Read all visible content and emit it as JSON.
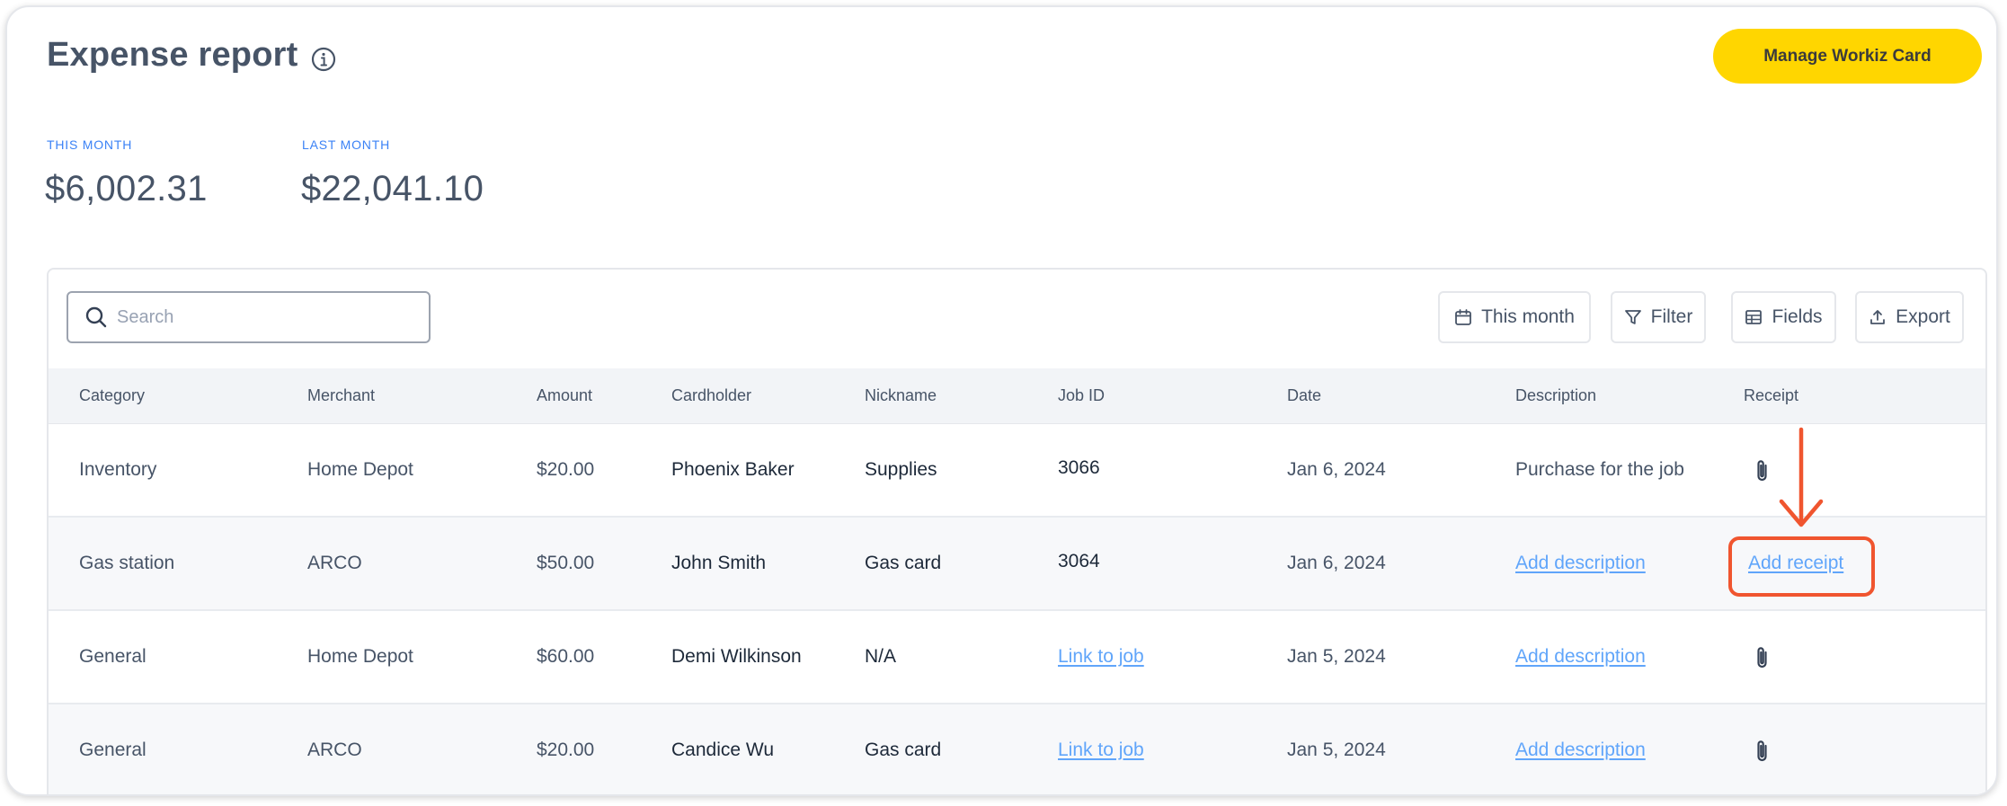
{
  "header": {
    "title": "Expense report",
    "manage_button": "Manage Workiz Card"
  },
  "stats": {
    "this_month_label": "THIS MONTH",
    "this_month_value": "$6,002.31",
    "last_month_label": "LAST MONTH",
    "last_month_value": "$22,041.10"
  },
  "toolbar": {
    "search_placeholder": "Search",
    "this_month": "This month",
    "filter": "Filter",
    "fields": "Fields",
    "export": "Export"
  },
  "table": {
    "columns": [
      "Category",
      "Merchant",
      "Amount",
      "Cardholder",
      "Nickname",
      "Job ID",
      "Date",
      "Description",
      "Receipt"
    ],
    "rows": [
      {
        "category": "Inventory",
        "merchant": "Home Depot",
        "amount": "$20.00",
        "cardholder": "Phoenix Baker",
        "nickname": "Supplies",
        "job_id": "3066",
        "date": "Jan 6, 2024",
        "description": "Purchase for the job",
        "receipt": "attachment-icon"
      },
      {
        "category": "Gas station",
        "merchant": "ARCO",
        "amount": "$50.00",
        "cardholder": "John Smith",
        "nickname": "Gas card",
        "job_id": "3064",
        "date": "Jan 6, 2024",
        "description": "Add description",
        "receipt": "Add receipt"
      },
      {
        "category": "General",
        "merchant": "Home Depot",
        "amount": "$60.00",
        "cardholder": "Demi Wilkinson",
        "nickname": "N/A",
        "job_id": "Link to job",
        "date": "Jan 5, 2024",
        "description": "Add description",
        "receipt": "attachment-icon"
      },
      {
        "category": "General",
        "merchant": "ARCO",
        "amount": "$20.00",
        "cardholder": "Candice Wu",
        "nickname": "Gas card",
        "job_id": "Link to job",
        "date": "Jan 5, 2024",
        "description": "Add description",
        "receipt": "attachment-icon"
      }
    ]
  },
  "colors": {
    "accent_yellow": "#ffd600",
    "link_blue": "#60a5fa",
    "highlight_orange": "#f0552f"
  }
}
